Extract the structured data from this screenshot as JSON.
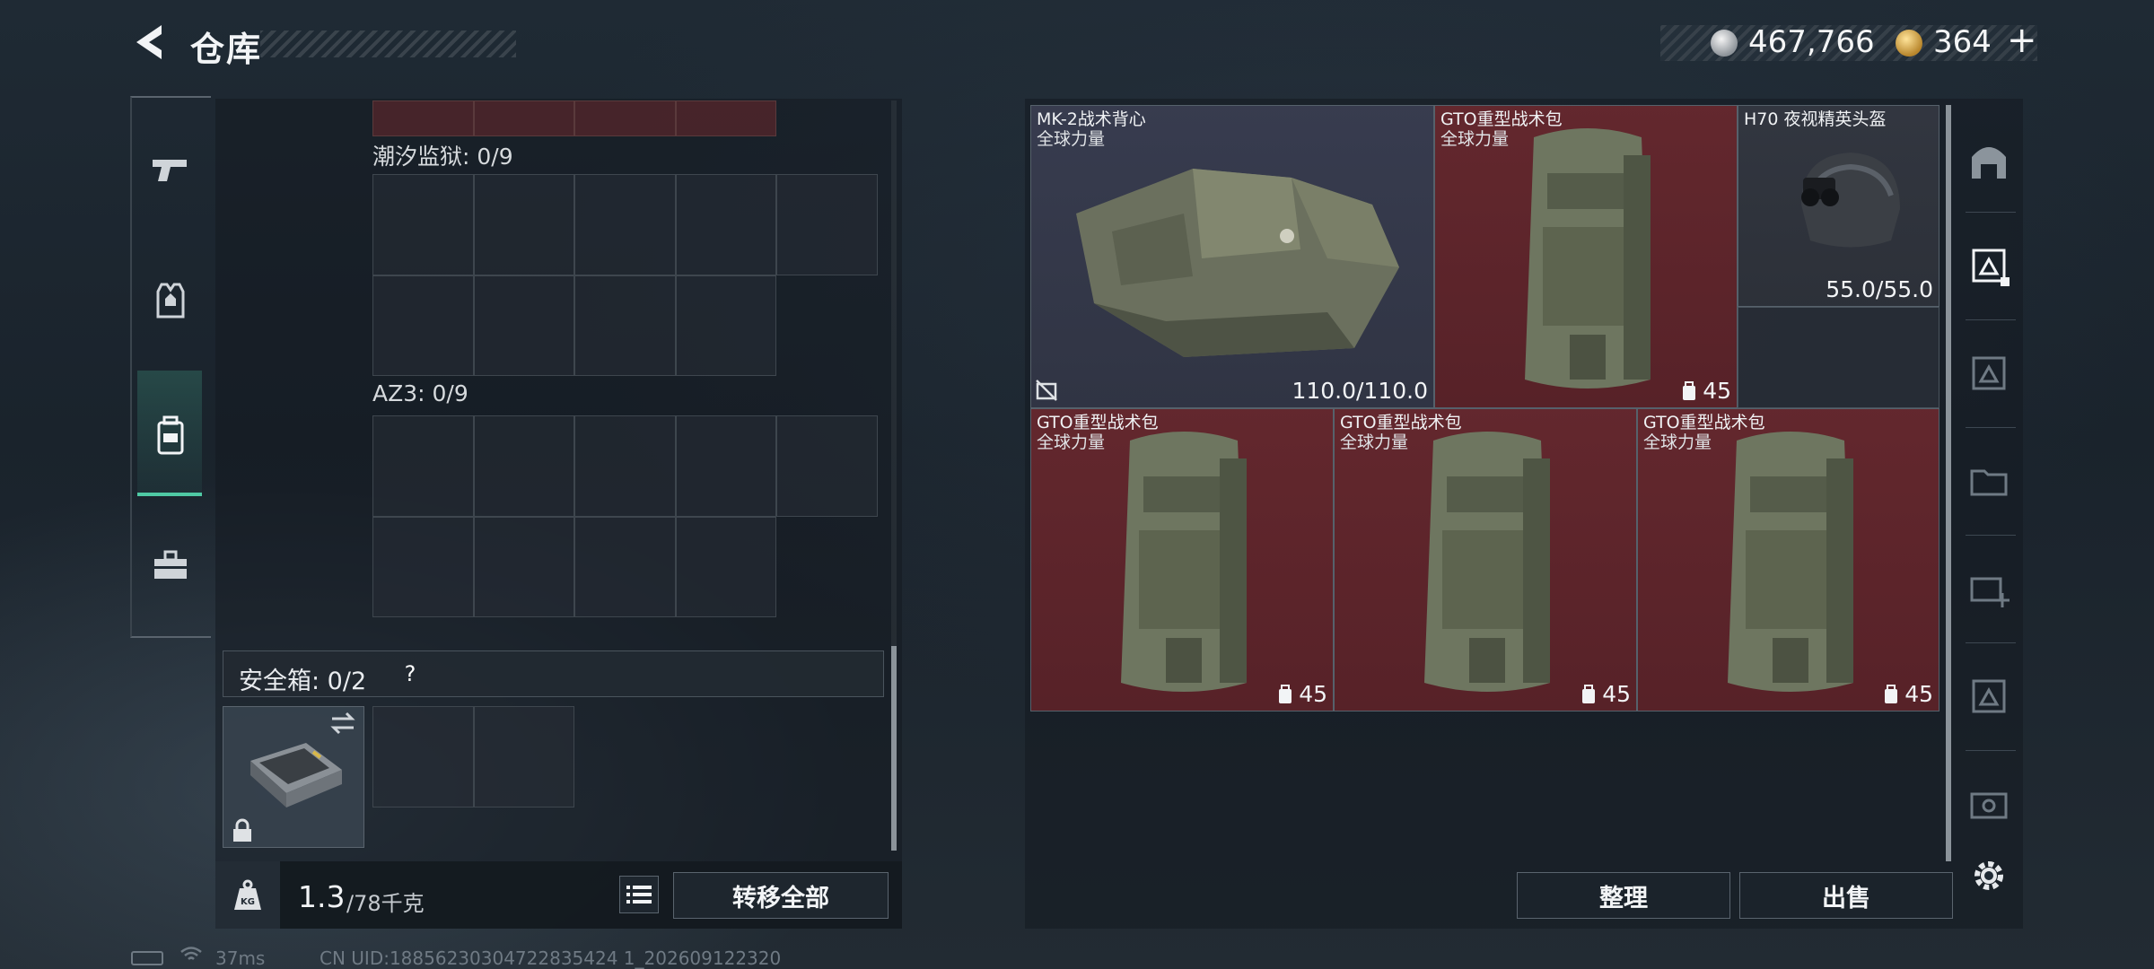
{
  "header": {
    "title": "仓库",
    "back_icon": "back-chevron-icon"
  },
  "currency": {
    "silver_amount": "467,766",
    "gold_amount": "364",
    "add_label": "+"
  },
  "left_rail": {
    "items": [
      {
        "name": "weapon",
        "icon": "pistol-icon"
      },
      {
        "name": "armor",
        "icon": "vest-icon"
      },
      {
        "name": "backpack",
        "icon": "backpack-icon",
        "active": true
      },
      {
        "name": "supplies",
        "icon": "toolbox-icon"
      }
    ]
  },
  "left_panel": {
    "grids": [
      {
        "label": "潮汐监狱: 0/9"
      },
      {
        "label": "AZ3: 0/9"
      }
    ],
    "safebox": {
      "label": "安全箱: 0/2",
      "help": "?"
    },
    "weight": {
      "current": "1.3",
      "max": "/78千克",
      "unit_icon": "kg-weight-icon"
    },
    "transfer_all_label": "转移全部"
  },
  "items": [
    {
      "name": "MK-2战术背心",
      "sub": "全球力量",
      "value": "110.0/110.0",
      "rarity": "gray"
    },
    {
      "name": "GTO重型战术包",
      "sub": "全球力量",
      "capacity": "45",
      "rarity": "red"
    },
    {
      "name": "H70 夜视精英头盔",
      "sub": "",
      "value": "55.0/55.0",
      "rarity": "dark"
    },
    {
      "name": "GTO重型战术包",
      "sub": "全球力量",
      "capacity": "45",
      "rarity": "red"
    },
    {
      "name": "GTO重型战术包",
      "sub": "全球力量",
      "capacity": "45",
      "rarity": "red"
    },
    {
      "name": "GTO重型战术包",
      "sub": "全球力量",
      "capacity": "45",
      "rarity": "red"
    }
  ],
  "actions": {
    "sort_label": "整理",
    "sell_label": "出售"
  },
  "status": {
    "ping": "37ms",
    "uid": "CN UID:18856230304722835424 1_202609122320"
  },
  "colors": {
    "accent": "#4fc9a4",
    "rarity_red": "#6a2a30",
    "rarity_gray": "#3a3e52"
  }
}
